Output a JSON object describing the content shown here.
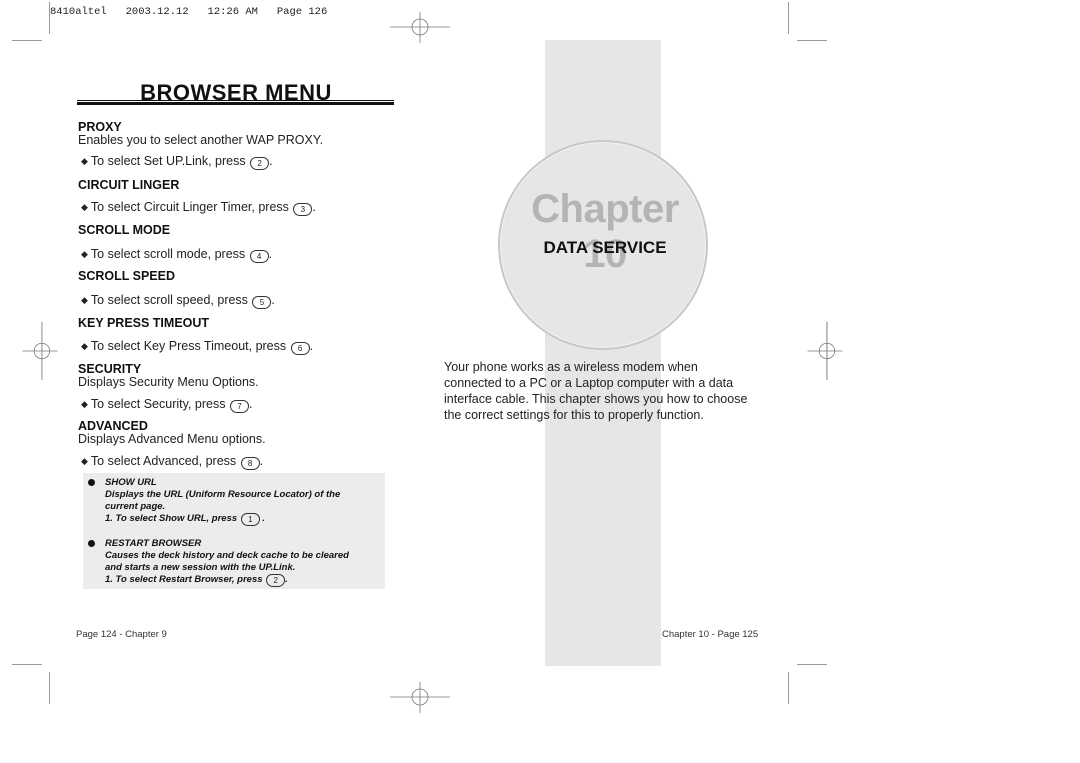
{
  "print_header": "8410altel   2003.12.12   12:26 AM   Page 126",
  "left_page": {
    "title": "BROWSER MENU",
    "sections": [
      {
        "heading": "PROXY",
        "description": "Enables you to select another WAP PROXY.",
        "instruction": "To select Set UP.Link, press",
        "key": "2ABC"
      },
      {
        "heading": "CIRCUIT LINGER",
        "instruction": "To select Circuit Linger Timer, press",
        "key": "3DEF"
      },
      {
        "heading": "SCROLL MODE",
        "instruction": "To select scroll mode, press",
        "key": "4GHI"
      },
      {
        "heading": "SCROLL SPEED",
        "instruction": "To select scroll speed, press",
        "key": "5JKL"
      },
      {
        "heading": "KEY PRESS TIMEOUT",
        "instruction": "To select Key Press Timeout, press",
        "key": "6MNO"
      },
      {
        "heading": "SECURITY",
        "description": "Displays Security Menu Options.",
        "instruction": "To select Security, press",
        "key": "7PQRS"
      },
      {
        "heading": "ADVANCED",
        "description": "Displays Advanced Menu options.",
        "instruction": "To select Advanced, press",
        "key": "8TUV"
      }
    ],
    "notes": [
      {
        "title": "SHOW URL",
        "line1": "Displays the URL (Uniform Resource Locator) of the",
        "line2": "current page.",
        "step": "1. To select Show URL, press",
        "key": "1"
      },
      {
        "title": "RESTART BROWSER",
        "line1": "Causes the deck history and deck cache to be cleared",
        "line2": "and starts a new session with the UP.Link.",
        "step": "1. To select Restart Browser, press",
        "key": "2ABC"
      }
    ],
    "footer": "Page 124 - Chapter 9"
  },
  "right_page": {
    "chapter_label": "Chapter 10",
    "chapter_title": "DATA SERVICE",
    "intro_lines": [
      "Your phone works as a wireless modem when",
      "connected to a PC or a Laptop computer with a data",
      "interface cable. This chapter shows you how to choose",
      "the correct settings for this to properly function."
    ],
    "footer": "Chapter 10 - Page 125"
  },
  "key_glyphs": {
    "2ABC": "2",
    "3DEF": "3",
    "4GHI": "4",
    "5JKL": "5",
    "6MNO": "6",
    "7PQRS": "7",
    "8TUV": "8",
    "1": "1"
  }
}
